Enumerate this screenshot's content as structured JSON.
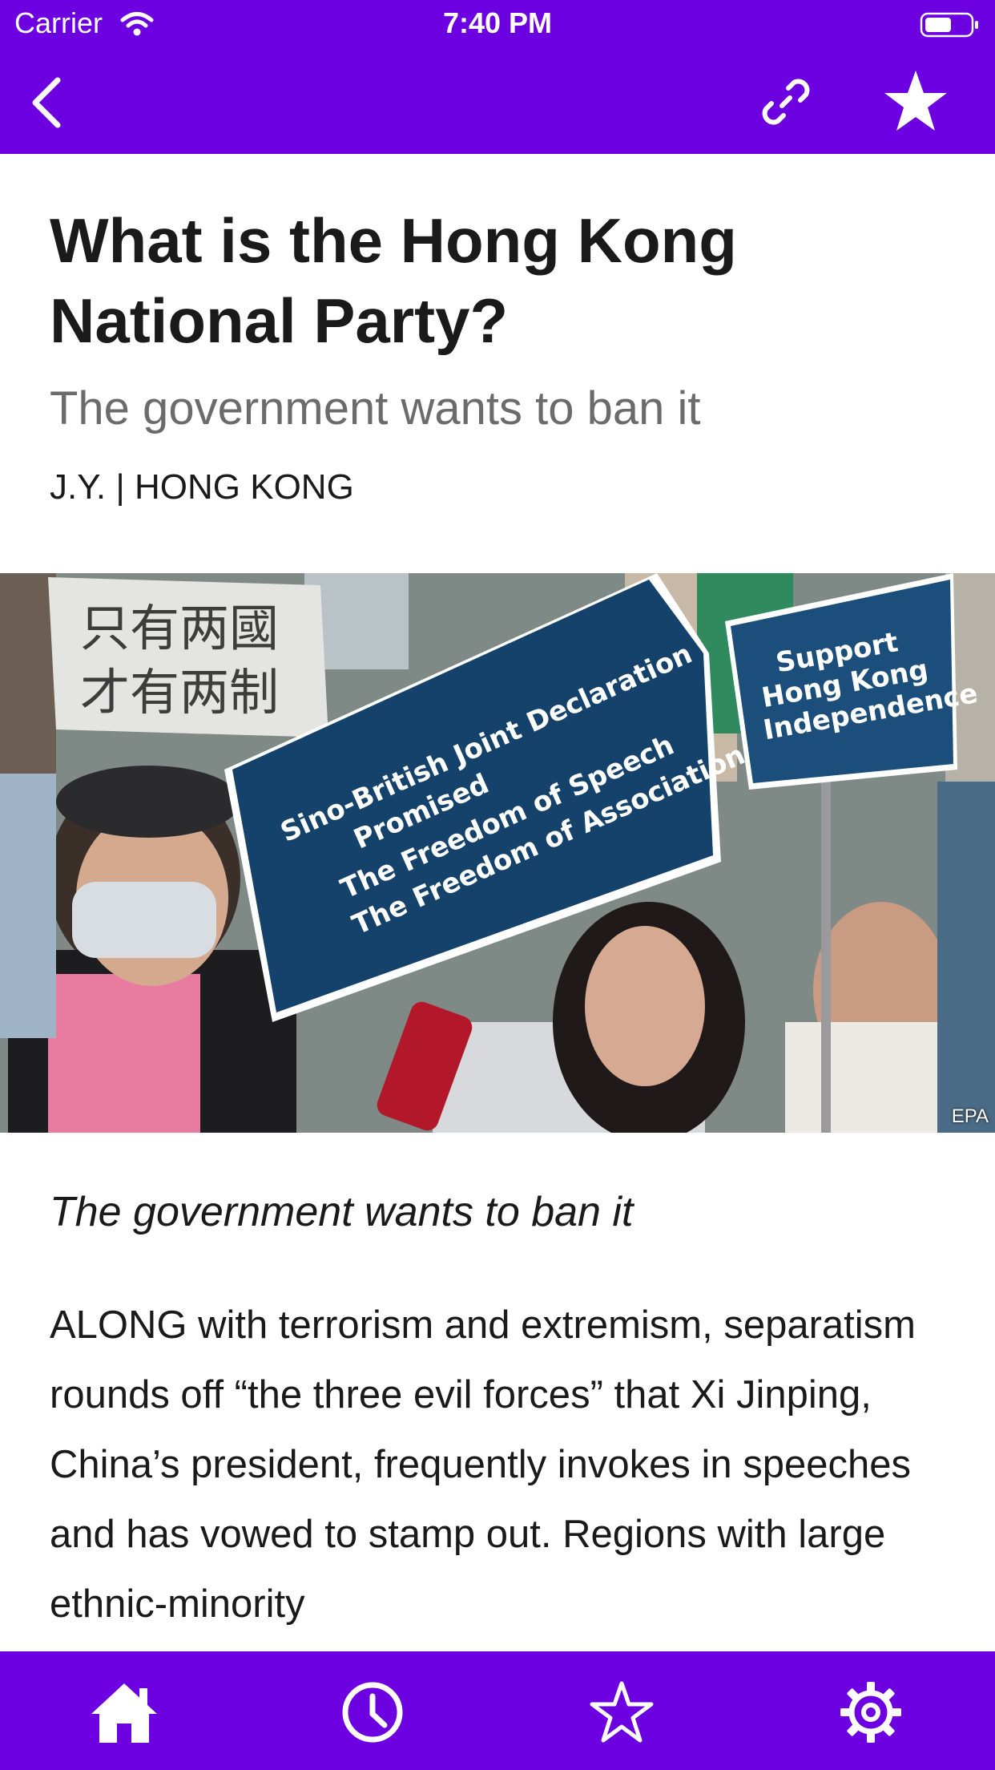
{
  "status_bar": {
    "carrier": "Carrier",
    "time": "7:40 PM"
  },
  "nav": {
    "back_icon": "chevron-left",
    "link_icon": "link-icon",
    "favorite_icon": "star-filled-icon"
  },
  "article": {
    "headline": "What is the Hong Kong National Party?",
    "rubric": "The government wants to ban it",
    "byline": "J.Y. | HONG KONG",
    "image": {
      "credit": "EPA",
      "placard_1_lines": [
        "Sino-British Joint Declaration",
        "Promised",
        "The Freedom of Speech",
        "The Freedom of Association"
      ],
      "placard_2_lines": [
        "Support",
        "Hong Kong",
        "Independence"
      ],
      "banner_text": "只有两國 才有两制"
    },
    "intro": "The government wants to ban it",
    "body": "ALONG with terrorism and extremism, separatism rounds off “the three evil forces” that Xi Jinping, China’s president, frequently invokes in speeches and has vowed to stamp out. Regions with large ethnic-minority"
  },
  "tab_bar": {
    "items": [
      {
        "icon": "home-icon"
      },
      {
        "icon": "clock-icon"
      },
      {
        "icon": "star-outline-icon"
      },
      {
        "icon": "gear-icon"
      }
    ]
  },
  "colors": {
    "accent": "#6c00e0",
    "text": "#1a1a1a",
    "muted": "#6b6b6b"
  }
}
